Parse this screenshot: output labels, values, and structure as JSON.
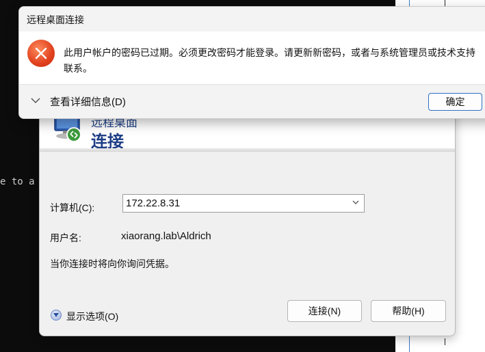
{
  "background": {
    "terminal_text": "e to a"
  },
  "rdp_window": {
    "subtitle": "远程桌面",
    "title": "连接",
    "computer_label": "计算机(C):",
    "computer_value": "172.22.8.31",
    "username_label": "用户名:",
    "username_value": "xiaorang.lab\\Aldrich",
    "info_text": "当你连接时将向你询问凭据。",
    "options_label": "显示选项(O)",
    "connect_button": "连接(N)",
    "help_button": "帮助(H)",
    "icon": "rdp-computer-icon"
  },
  "message_box": {
    "title": "远程桌面连接",
    "message": "此用户帐户的密码已过期。必须更改密码才能登录。请更新新密码，或者与系统管理员或技术支持联系。",
    "details_label": "查看详细信息(D)",
    "ok_button": "确定",
    "icon": "error-icon"
  },
  "colors": {
    "accent_blue": "#1f3f86",
    "error_red": "#e0401d",
    "focus_border": "#2f6fc4"
  }
}
